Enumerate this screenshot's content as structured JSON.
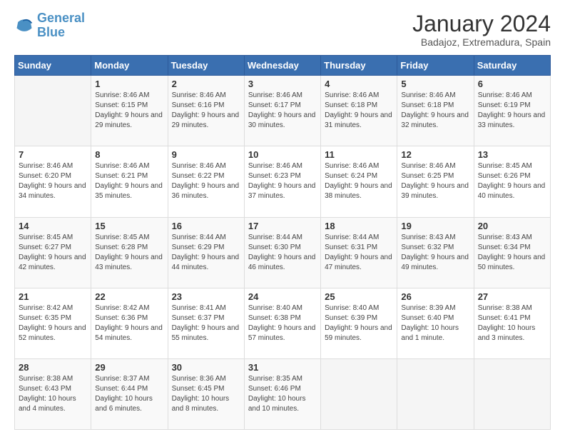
{
  "logo": {
    "line1": "General",
    "line2": "Blue"
  },
  "title": "January 2024",
  "subtitle": "Badajoz, Extremadura, Spain",
  "weekdays": [
    "Sunday",
    "Monday",
    "Tuesday",
    "Wednesday",
    "Thursday",
    "Friday",
    "Saturday"
  ],
  "weeks": [
    [
      {
        "day": "",
        "sunrise": "",
        "sunset": "",
        "daylight": ""
      },
      {
        "day": "1",
        "sunrise": "Sunrise: 8:46 AM",
        "sunset": "Sunset: 6:15 PM",
        "daylight": "Daylight: 9 hours and 29 minutes."
      },
      {
        "day": "2",
        "sunrise": "Sunrise: 8:46 AM",
        "sunset": "Sunset: 6:16 PM",
        "daylight": "Daylight: 9 hours and 29 minutes."
      },
      {
        "day": "3",
        "sunrise": "Sunrise: 8:46 AM",
        "sunset": "Sunset: 6:17 PM",
        "daylight": "Daylight: 9 hours and 30 minutes."
      },
      {
        "day": "4",
        "sunrise": "Sunrise: 8:46 AM",
        "sunset": "Sunset: 6:18 PM",
        "daylight": "Daylight: 9 hours and 31 minutes."
      },
      {
        "day": "5",
        "sunrise": "Sunrise: 8:46 AM",
        "sunset": "Sunset: 6:18 PM",
        "daylight": "Daylight: 9 hours and 32 minutes."
      },
      {
        "day": "6",
        "sunrise": "Sunrise: 8:46 AM",
        "sunset": "Sunset: 6:19 PM",
        "daylight": "Daylight: 9 hours and 33 minutes."
      }
    ],
    [
      {
        "day": "7",
        "sunrise": "Sunrise: 8:46 AM",
        "sunset": "Sunset: 6:20 PM",
        "daylight": "Daylight: 9 hours and 34 minutes."
      },
      {
        "day": "8",
        "sunrise": "Sunrise: 8:46 AM",
        "sunset": "Sunset: 6:21 PM",
        "daylight": "Daylight: 9 hours and 35 minutes."
      },
      {
        "day": "9",
        "sunrise": "Sunrise: 8:46 AM",
        "sunset": "Sunset: 6:22 PM",
        "daylight": "Daylight: 9 hours and 36 minutes."
      },
      {
        "day": "10",
        "sunrise": "Sunrise: 8:46 AM",
        "sunset": "Sunset: 6:23 PM",
        "daylight": "Daylight: 9 hours and 37 minutes."
      },
      {
        "day": "11",
        "sunrise": "Sunrise: 8:46 AM",
        "sunset": "Sunset: 6:24 PM",
        "daylight": "Daylight: 9 hours and 38 minutes."
      },
      {
        "day": "12",
        "sunrise": "Sunrise: 8:46 AM",
        "sunset": "Sunset: 6:25 PM",
        "daylight": "Daylight: 9 hours and 39 minutes."
      },
      {
        "day": "13",
        "sunrise": "Sunrise: 8:45 AM",
        "sunset": "Sunset: 6:26 PM",
        "daylight": "Daylight: 9 hours and 40 minutes."
      }
    ],
    [
      {
        "day": "14",
        "sunrise": "Sunrise: 8:45 AM",
        "sunset": "Sunset: 6:27 PM",
        "daylight": "Daylight: 9 hours and 42 minutes."
      },
      {
        "day": "15",
        "sunrise": "Sunrise: 8:45 AM",
        "sunset": "Sunset: 6:28 PM",
        "daylight": "Daylight: 9 hours and 43 minutes."
      },
      {
        "day": "16",
        "sunrise": "Sunrise: 8:44 AM",
        "sunset": "Sunset: 6:29 PM",
        "daylight": "Daylight: 9 hours and 44 minutes."
      },
      {
        "day": "17",
        "sunrise": "Sunrise: 8:44 AM",
        "sunset": "Sunset: 6:30 PM",
        "daylight": "Daylight: 9 hours and 46 minutes."
      },
      {
        "day": "18",
        "sunrise": "Sunrise: 8:44 AM",
        "sunset": "Sunset: 6:31 PM",
        "daylight": "Daylight: 9 hours and 47 minutes."
      },
      {
        "day": "19",
        "sunrise": "Sunrise: 8:43 AM",
        "sunset": "Sunset: 6:32 PM",
        "daylight": "Daylight: 9 hours and 49 minutes."
      },
      {
        "day": "20",
        "sunrise": "Sunrise: 8:43 AM",
        "sunset": "Sunset: 6:34 PM",
        "daylight": "Daylight: 9 hours and 50 minutes."
      }
    ],
    [
      {
        "day": "21",
        "sunrise": "Sunrise: 8:42 AM",
        "sunset": "Sunset: 6:35 PM",
        "daylight": "Daylight: 9 hours and 52 minutes."
      },
      {
        "day": "22",
        "sunrise": "Sunrise: 8:42 AM",
        "sunset": "Sunset: 6:36 PM",
        "daylight": "Daylight: 9 hours and 54 minutes."
      },
      {
        "day": "23",
        "sunrise": "Sunrise: 8:41 AM",
        "sunset": "Sunset: 6:37 PM",
        "daylight": "Daylight: 9 hours and 55 minutes."
      },
      {
        "day": "24",
        "sunrise": "Sunrise: 8:40 AM",
        "sunset": "Sunset: 6:38 PM",
        "daylight": "Daylight: 9 hours and 57 minutes."
      },
      {
        "day": "25",
        "sunrise": "Sunrise: 8:40 AM",
        "sunset": "Sunset: 6:39 PM",
        "daylight": "Daylight: 9 hours and 59 minutes."
      },
      {
        "day": "26",
        "sunrise": "Sunrise: 8:39 AM",
        "sunset": "Sunset: 6:40 PM",
        "daylight": "Daylight: 10 hours and 1 minute."
      },
      {
        "day": "27",
        "sunrise": "Sunrise: 8:38 AM",
        "sunset": "Sunset: 6:41 PM",
        "daylight": "Daylight: 10 hours and 3 minutes."
      }
    ],
    [
      {
        "day": "28",
        "sunrise": "Sunrise: 8:38 AM",
        "sunset": "Sunset: 6:43 PM",
        "daylight": "Daylight: 10 hours and 4 minutes."
      },
      {
        "day": "29",
        "sunrise": "Sunrise: 8:37 AM",
        "sunset": "Sunset: 6:44 PM",
        "daylight": "Daylight: 10 hours and 6 minutes."
      },
      {
        "day": "30",
        "sunrise": "Sunrise: 8:36 AM",
        "sunset": "Sunset: 6:45 PM",
        "daylight": "Daylight: 10 hours and 8 minutes."
      },
      {
        "day": "31",
        "sunrise": "Sunrise: 8:35 AM",
        "sunset": "Sunset: 6:46 PM",
        "daylight": "Daylight: 10 hours and 10 minutes."
      },
      {
        "day": "",
        "sunrise": "",
        "sunset": "",
        "daylight": ""
      },
      {
        "day": "",
        "sunrise": "",
        "sunset": "",
        "daylight": ""
      },
      {
        "day": "",
        "sunrise": "",
        "sunset": "",
        "daylight": ""
      }
    ]
  ]
}
